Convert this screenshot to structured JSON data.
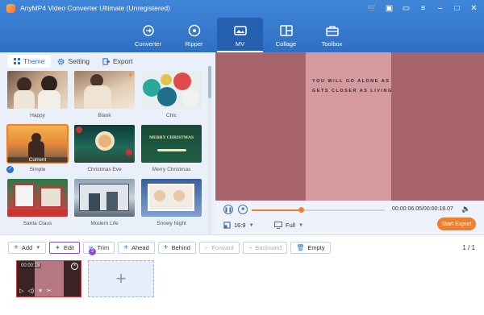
{
  "app": {
    "title": "AnyMP4 Video Converter Ultimate (Unregistered)"
  },
  "window_controls": [
    "cart-icon",
    "gift-icon",
    "chat-icon",
    "menu-icon",
    "minimize-icon",
    "maximize-icon",
    "close-icon"
  ],
  "main_tabs": [
    {
      "label": "Converter",
      "icon": "converter-icon"
    },
    {
      "label": "Ripper",
      "icon": "disc-icon"
    },
    {
      "label": "MV",
      "icon": "mv-icon",
      "active": true
    },
    {
      "label": "Collage",
      "icon": "collage-icon"
    },
    {
      "label": "Toolbox",
      "icon": "toolbox-icon"
    }
  ],
  "subtabs": [
    {
      "label": "Theme",
      "active": true
    },
    {
      "label": "Setting"
    },
    {
      "label": "Export"
    }
  ],
  "themes": [
    {
      "name": "Happy"
    },
    {
      "name": "Blank"
    },
    {
      "name": "Chic"
    },
    {
      "name": "Simple",
      "selected": true,
      "overlay": "Current"
    },
    {
      "name": "Christmas Eve"
    },
    {
      "name": "Merry Christmas",
      "overlay_text": "MERRY CHRISTMAS"
    },
    {
      "name": "Santa Claus"
    },
    {
      "name": "Modern Life"
    },
    {
      "name": "Snowy Night"
    }
  ],
  "preview": {
    "letters": "YOU WILL GO ALONE AS GETS CLOSER AS LIVING"
  },
  "player": {
    "time": "00:00:06.05/00:00:18.07",
    "progress": 0.37,
    "ratio": "16:9",
    "display": "Full",
    "start_export": "Start Export"
  },
  "toolbar": {
    "add": "Add",
    "edit": "Edit",
    "trim": "Trim",
    "ahead": "Ahead",
    "behind": "Behind",
    "forward": "Forward",
    "backward": "Backward",
    "empty": "Empty",
    "badge": "2",
    "pager": "1 / 1"
  },
  "clip": {
    "duration": "00:00:18"
  },
  "colors": {
    "accent": "#f07e2f",
    "brand": "#2f6fc4",
    "highlight": "#8a4ad8"
  }
}
